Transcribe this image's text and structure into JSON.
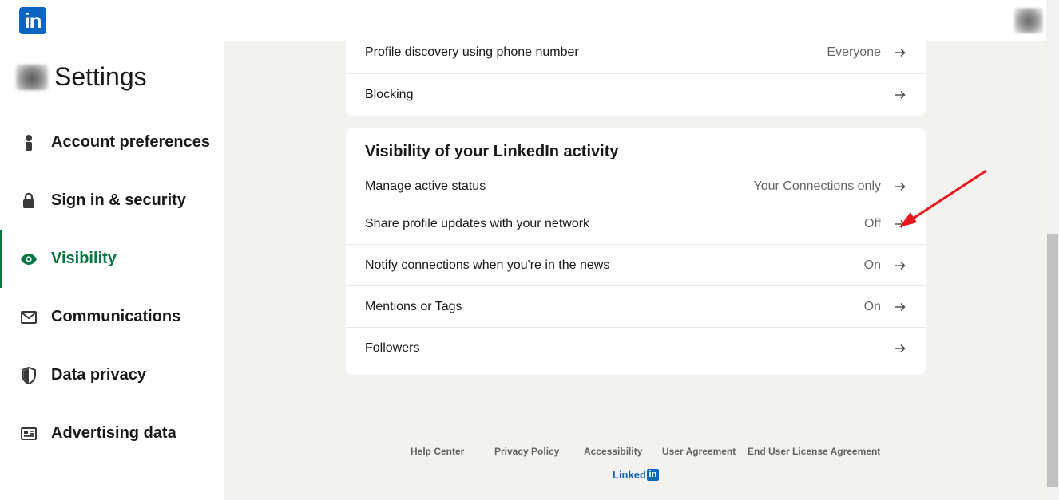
{
  "header": {
    "logo_text": "in"
  },
  "sidebar": {
    "title": "Settings",
    "items": [
      {
        "label": "Account preferences",
        "icon": "person-icon"
      },
      {
        "label": "Sign in & security",
        "icon": "lock-icon"
      },
      {
        "label": "Visibility",
        "icon": "eye-icon",
        "active": true
      },
      {
        "label": "Communications",
        "icon": "envelope-icon"
      },
      {
        "label": "Data privacy",
        "icon": "shield-icon"
      },
      {
        "label": "Advertising data",
        "icon": "ad-icon"
      }
    ]
  },
  "profile_network_card": {
    "rows": [
      {
        "label": "Profile discovery using phone number",
        "value": "Everyone"
      },
      {
        "label": "Blocking",
        "value": ""
      }
    ]
  },
  "activity_card": {
    "title": "Visibility of your LinkedIn activity",
    "rows": [
      {
        "label": "Manage active status",
        "value": "Your Connections only"
      },
      {
        "label": "Share profile updates with your network",
        "value": "Off"
      },
      {
        "label": "Notify connections when you're in the news",
        "value": "On"
      },
      {
        "label": "Mentions or Tags",
        "value": "On"
      },
      {
        "label": "Followers",
        "value": ""
      }
    ]
  },
  "footer": {
    "links": [
      "Help Center",
      "Privacy Policy",
      "Accessibility",
      "User Agreement",
      "End User License Agreement"
    ],
    "brand_text": "Linked",
    "brand_badge": "in"
  },
  "colors": {
    "accent_green": "#057642",
    "brand_blue": "#0a66c2",
    "annotation_red": "#e8141b"
  }
}
